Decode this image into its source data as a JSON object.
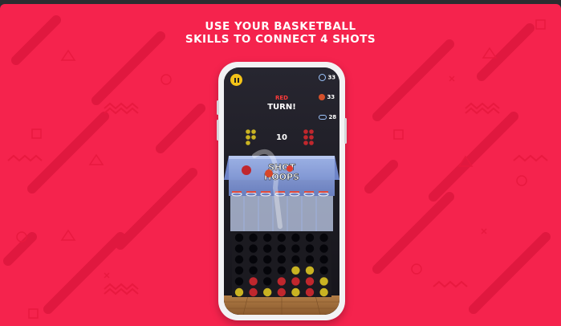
{
  "headline": {
    "line1": "USE YOUR BASKETBALL",
    "line2": "SKILLS TO CONNECT 4 SHOTS"
  },
  "game": {
    "turn_color_label": "RED",
    "turn_label": "TURN!",
    "center_count": "10",
    "stats": [
      {
        "icon": "timer-icon",
        "value": "33"
      },
      {
        "icon": "basketball-icon",
        "value": "33"
      },
      {
        "icon": "hoop-icon",
        "value": "28"
      }
    ],
    "logo_text_line1": "SHOT",
    "logo_text_line2": "HOOPS"
  },
  "colors": {
    "background": "#f5234d",
    "accent_yellow": "#f3c318",
    "red_piece": "#c0272d",
    "yellow_piece": "#c9b322"
  }
}
